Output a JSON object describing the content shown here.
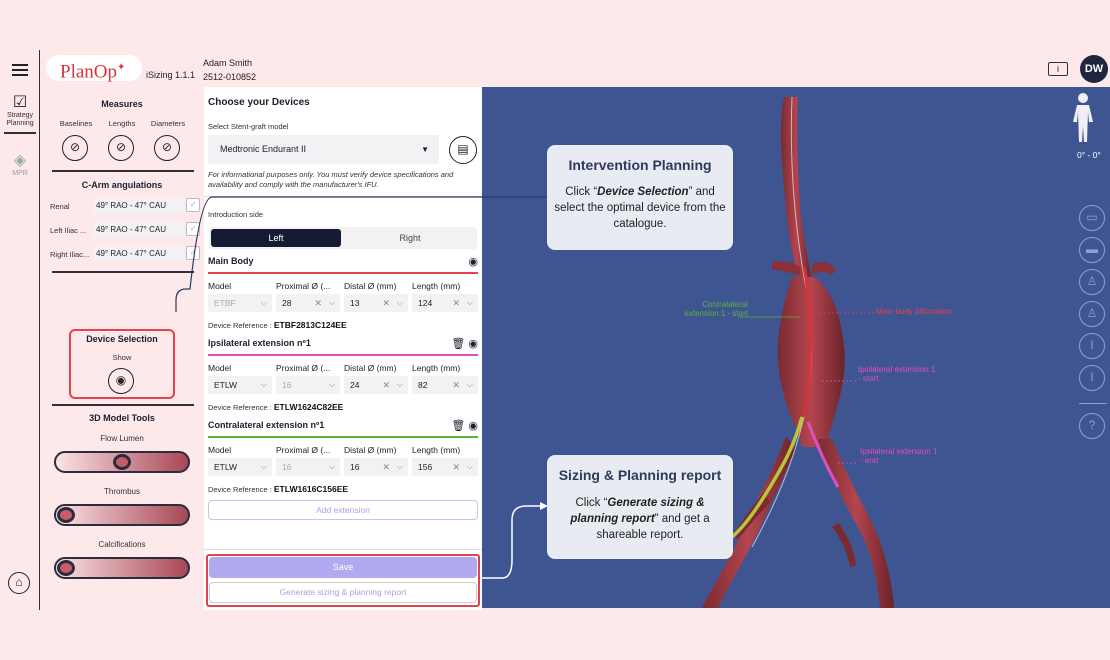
{
  "rail": {
    "strategy_label": "Strategy Planning",
    "mpr_label": "MPR"
  },
  "topbar": {
    "logo": "PlanOp",
    "version": "iSizing 1.1.1",
    "user_name": "Adam Smith",
    "case_id": "2512-010852",
    "avatar_initials": "DW"
  },
  "measures": {
    "title": "Measures",
    "items": [
      "Baselines",
      "Lengths",
      "Diameters"
    ]
  },
  "carm": {
    "title": "C-Arm angulations",
    "rows": [
      {
        "name": "Renal",
        "value": "49° RAO - 47° CAU"
      },
      {
        "name": "Left Iliac ...",
        "value": "49° RAO - 47° CAU"
      },
      {
        "name": "Right Iliac...",
        "value": "49° RAO - 47° CAU"
      }
    ]
  },
  "device_selection": {
    "title": "Device Selection",
    "show_label": "Show"
  },
  "model_tools": {
    "title": "3D Model Tools",
    "sliders": [
      {
        "label": "Flow Lumen",
        "level": 0.5
      },
      {
        "label": "Thrombus",
        "level": 0.0
      },
      {
        "label": "Calcifications",
        "level": 0.0
      }
    ]
  },
  "devices": {
    "title": "Choose your Devices",
    "model_label": "Select Stent-graft model",
    "model_value": "Medtronic Endurant II",
    "disclaimer": "For informational purposes only. You must verify device specifications and availability and comply with the manufacturer's IFU.",
    "intro_label": "Introduction side",
    "sides": [
      "Left",
      "Right"
    ],
    "columns": [
      "Model",
      "Proximal Ø (...",
      "Distal Ø (mm)",
      "Length (mm)"
    ],
    "ref_label": "Device Reference :",
    "parts": [
      {
        "name": "Main Body",
        "model": "ETBF",
        "proximal": "28",
        "distal": "13",
        "length": "124",
        "reference": "ETBF2813C124EE",
        "color": "#e2434d"
      },
      {
        "name": "Ipsilateral extension nº1",
        "model": "ETLW",
        "proximal": "16",
        "distal": "24",
        "length": "82",
        "reference": "ETLW1624C82EE",
        "color": "#e04fc0"
      },
      {
        "name": "Contralateral extension nº1",
        "model": "ETLW",
        "proximal": "16",
        "distal": "16",
        "length": "156",
        "reference": "ETLW1616C156EE",
        "color": "#59b43a"
      }
    ],
    "add_extension": "Add extension",
    "save": "Save",
    "generate": "Generate sizing & planning report"
  },
  "callouts": {
    "intervention": {
      "title": "Intervention Planning",
      "pre": "Click “",
      "em": "Device Selection",
      "post": "” and select the optimal device from the catalogue."
    },
    "report": {
      "title": "Sizing & Planning report",
      "pre": "Click “",
      "em": "Generate sizing & planning report",
      "post": "” and get a shareable report."
    }
  },
  "viewer": {
    "angle": "0° - 0°",
    "labels": {
      "contra_start": "Contralateral extension 1 - start",
      "main_bif": "Main body bifurcation",
      "ipsi_start": "Ipsilateral extension 1 - start",
      "ipsi_end": "Ipsilateral extension 1 - end"
    },
    "colors": {
      "background": "#3e5591",
      "green": "#59b43a",
      "magenta": "#e04fc0",
      "red": "#e2434d"
    }
  }
}
